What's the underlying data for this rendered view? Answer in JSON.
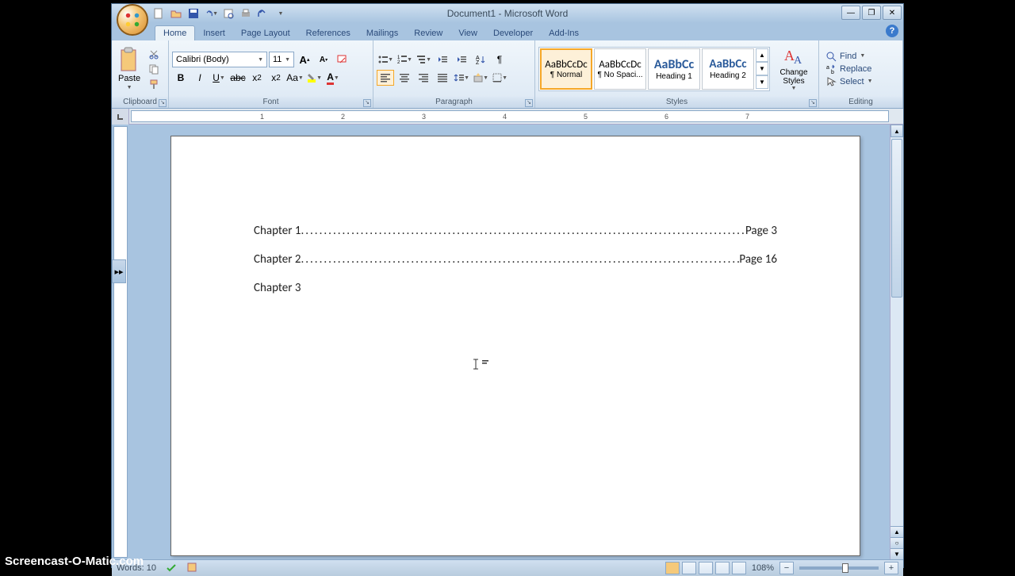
{
  "window": {
    "title": "Document1 - Microsoft Word"
  },
  "tabs": {
    "home": "Home",
    "insert": "Insert",
    "page_layout": "Page Layout",
    "references": "References",
    "mailings": "Mailings",
    "review": "Review",
    "view": "View",
    "developer": "Developer",
    "addins": "Add-Ins"
  },
  "groups": {
    "clipboard": "Clipboard",
    "font": "Font",
    "paragraph": "Paragraph",
    "styles": "Styles",
    "editing": "Editing"
  },
  "clipboard": {
    "paste": "Paste"
  },
  "font": {
    "name": "Calibri (Body)",
    "size": "11"
  },
  "styles": {
    "items": [
      {
        "preview": "AaBbCcDc",
        "label": "¶ Normal"
      },
      {
        "preview": "AaBbCcDc",
        "label": "¶ No Spaci..."
      },
      {
        "preview": "AaBbCc",
        "label": "Heading 1"
      },
      {
        "preview": "AaBbCc",
        "label": "Heading 2"
      }
    ],
    "change": "Change Styles"
  },
  "editing": {
    "find": "Find",
    "replace": "Replace",
    "select": "Select"
  },
  "document": {
    "lines": [
      {
        "chapter": "Chapter 1",
        "page": "Page 3"
      },
      {
        "chapter": "Chapter 2",
        "page": "Page 16"
      },
      {
        "chapter": "Chapter 3",
        "page": ""
      }
    ]
  },
  "status": {
    "words_label": "Words:",
    "words": "10",
    "zoom": "108%"
  },
  "watermark": "Screencast-O-Matic.com",
  "ruler": {
    "n1": "1",
    "n2": "2",
    "n3": "3",
    "n4": "4",
    "n5": "5",
    "n6": "6",
    "n7": "7"
  }
}
